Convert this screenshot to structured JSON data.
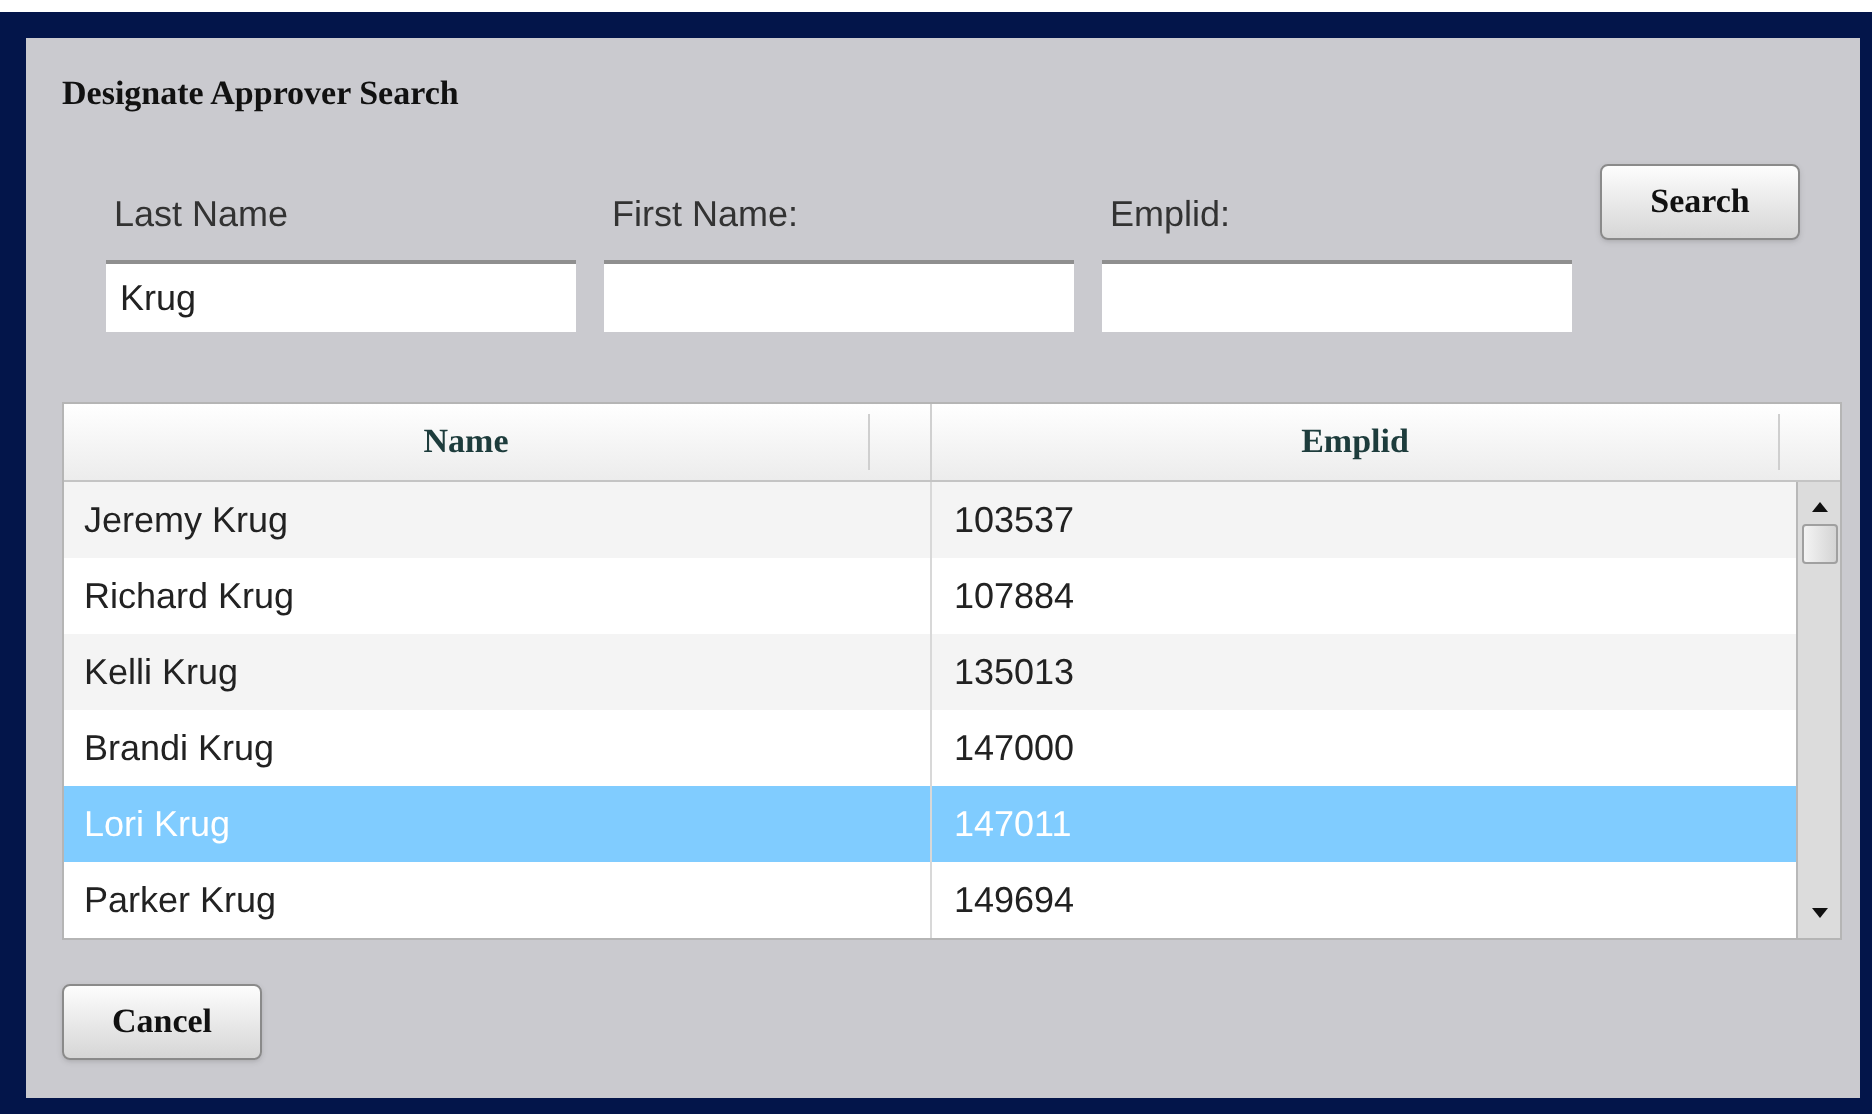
{
  "dialog": {
    "title": "Designate Approver Search"
  },
  "fields": [
    {
      "label": "Last Name",
      "value": "Krug"
    },
    {
      "label": "First Name:"
    },
    {
      "label": "Emplid:"
    }
  ],
  "search_button": "Search",
  "table": {
    "columns": [
      "Name",
      "Emplid"
    ],
    "rows": [
      {
        "name": "Jeremy Krug",
        "emplid": "103537",
        "selected": false
      },
      {
        "name": "Richard Krug",
        "emplid": "107884",
        "selected": false
      },
      {
        "name": "Kelli Krug",
        "emplid": "135013",
        "selected": false
      },
      {
        "name": "Brandi Krug",
        "emplid": "147000",
        "selected": false
      },
      {
        "name": "Lori Krug",
        "emplid": "147011",
        "selected": true
      },
      {
        "name": "Parker Krug",
        "emplid": "149694",
        "selected": false
      }
    ]
  },
  "cancel_button": "Cancel"
}
